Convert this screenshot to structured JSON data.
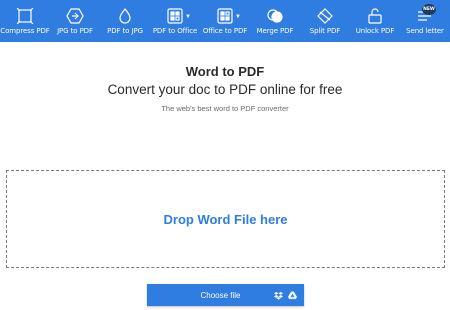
{
  "toolbar": {
    "items": [
      {
        "label": "Compress PDF",
        "icon": "compress-icon"
      },
      {
        "label": "JPG to PDF",
        "icon": "jpg-to-pdf-icon"
      },
      {
        "label": "PDF to JPG",
        "icon": "drop-icon"
      },
      {
        "label": "PDF to Office",
        "icon": "office-grid-icon",
        "has_dropdown": true
      },
      {
        "label": "Office to PDF",
        "icon": "office-grid-icon",
        "has_dropdown": true
      },
      {
        "label": "Merge PDF",
        "icon": "merge-icon"
      },
      {
        "label": "Split PDF",
        "icon": "split-icon"
      },
      {
        "label": "Unlock PDF",
        "icon": "unlock-icon"
      },
      {
        "label": "Send letter",
        "icon": "send-letter-icon",
        "badge": "NEW"
      }
    ]
  },
  "main": {
    "title": "Word to PDF",
    "subtitle": "Convert your doc to PDF online for free",
    "tagline": "The web's best word to PDF converter"
  },
  "dropzone": {
    "label": "Drop Word File here"
  },
  "choose": {
    "label": "Choose file",
    "icons": [
      "dropbox-icon",
      "google-drive-icon"
    ]
  },
  "colors": {
    "accent": "#2f7de1",
    "text": "#2a2a2a",
    "muted": "#6b6b6b"
  }
}
